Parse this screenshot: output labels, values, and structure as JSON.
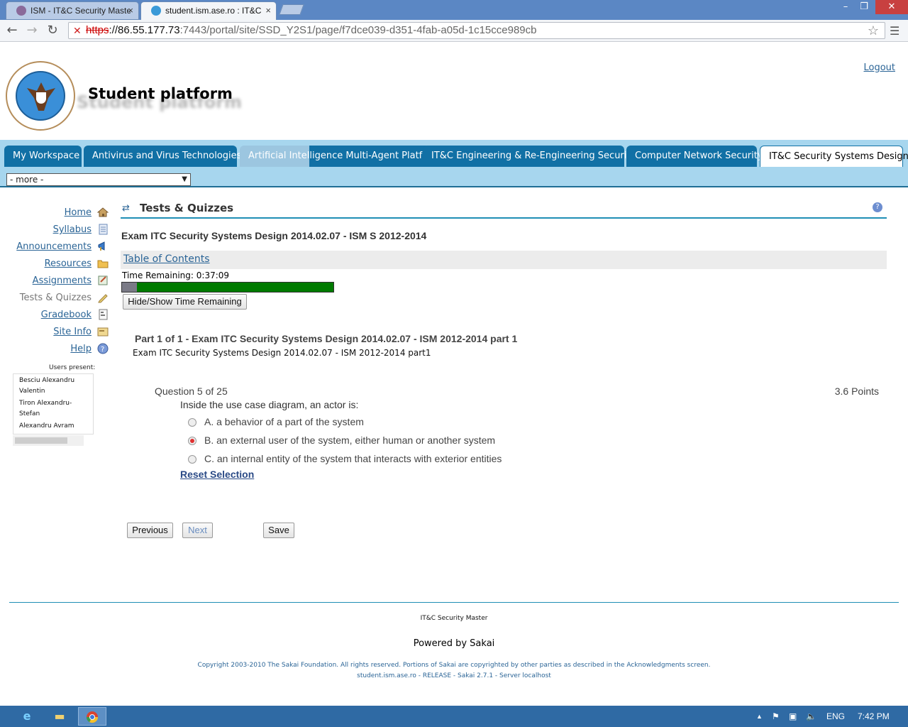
{
  "browser": {
    "tabs": [
      {
        "title": "ISM - IT&C Security Maste",
        "active": false
      },
      {
        "title": "student.ism.ase.ro : IT&C",
        "active": true
      }
    ],
    "url_https": "https",
    "url_host": "://86.55.177.73",
    "url_path": ":7443/portal/site/SSD_Y2S1/page/f7dce039-d351-4fab-a05d-1c15cce989cb"
  },
  "header": {
    "site_title": "Student platform",
    "logout": "Logout"
  },
  "site_tabs": [
    {
      "label": "My Workspace"
    },
    {
      "label": "Antivirus and Virus Technologies"
    },
    {
      "label": "Artificial Intelligence Multi-Agent Platforms"
    },
    {
      "label": "IT&C Engineering & Re-Engineering Security"
    },
    {
      "label": "Computer Network Security"
    },
    {
      "label": "IT&C Security Systems Design"
    }
  ],
  "more_select": "- more -",
  "tools": [
    {
      "label": "Home",
      "icon": "home-icon"
    },
    {
      "label": "Syllabus",
      "icon": "syllabus-icon"
    },
    {
      "label": "Announcements",
      "icon": "megaphone-icon"
    },
    {
      "label": "Resources",
      "icon": "folder-icon"
    },
    {
      "label": "Assignments",
      "icon": "assignment-icon"
    },
    {
      "label": "Tests & Quizzes",
      "icon": "pencil-icon"
    },
    {
      "label": "Gradebook",
      "icon": "gradebook-icon"
    },
    {
      "label": "Site Info",
      "icon": "site-info-icon"
    },
    {
      "label": "Help",
      "icon": "help-icon"
    }
  ],
  "presence": {
    "label": "Users present:",
    "users": [
      "Besciu Alexandru",
      "Valentin",
      "Tiron Alexandru-",
      "Stefan",
      "Alexandru Avram"
    ]
  },
  "main": {
    "tool_title": "Tests & Quizzes",
    "exam_title": "Exam ITC Security Systems Design 2014.02.07 - ISM S 2012-2014",
    "toc_link": "Table of Contents",
    "time_remaining": "Time Remaining: 0:37:09",
    "time_elapsed_fraction": 0.07,
    "hide_show_button": "Hide/Show Time Remaining",
    "part_title": "Part 1 of 1 - Exam ITC Security Systems Design 2014.02.07 - ISM 2012-2014 part 1",
    "part_subtitle": "Exam ITC Security Systems Design 2014.02.07 - ISM 2012-2014 part1",
    "question_number": "Question 5 of 25",
    "points": "3.6 Points",
    "question_text": "Inside the use case diagram, an actor is:",
    "answers": [
      {
        "text": "A. a behavior of a part of the system",
        "selected": false
      },
      {
        "text": "B. an external user of the system, either human or another system",
        "selected": true
      },
      {
        "text": "C. an internal entity of the system that interacts with exterior entities",
        "selected": false
      }
    ],
    "reset_selection": "Reset Selection",
    "previous_button": "Previous",
    "next_button": "Next",
    "save_button": "Save"
  },
  "footer": {
    "org": "IT&C Security Master",
    "powered": "Powered by Sakai",
    "copyright": "Copyright 2003-2010 The Sakai Foundation. All rights reserved. Portions of Sakai are copyrighted by other parties as described in the Acknowledgments screen.",
    "server": "student.ism.ase.ro - RELEASE - Sakai 2.7.1 - Server localhost"
  },
  "taskbar": {
    "language": "ENG",
    "clock": "7:42 PM"
  },
  "colors": {
    "sakai_tab": "#1170a5",
    "nav_band": "#a7d6ee",
    "link": "#2a6496",
    "timer_fill": "#007a00"
  }
}
